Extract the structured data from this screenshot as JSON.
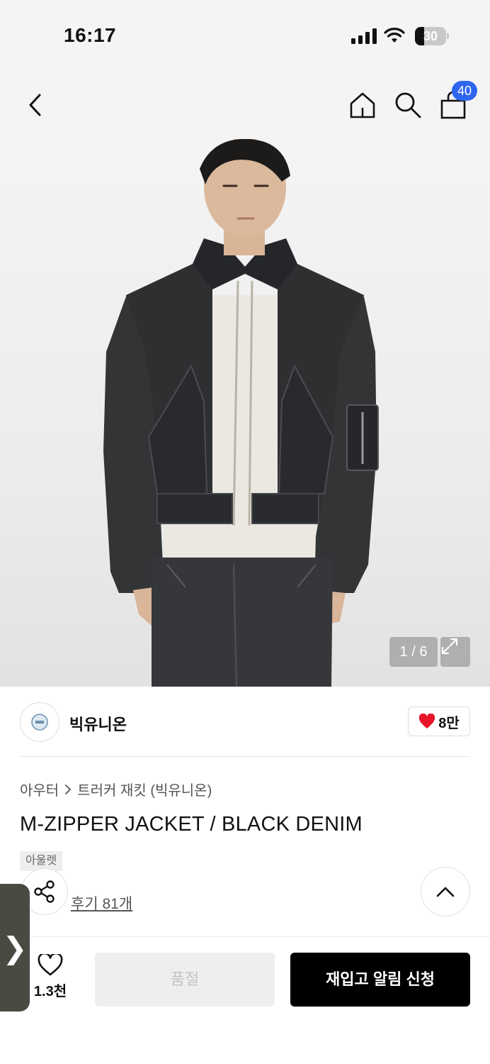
{
  "status_bar": {
    "time": "16:17",
    "battery": "30",
    "battery_level": 0.3
  },
  "nav": {
    "back_icon": "chevron-left-icon",
    "home_icon": "home-icon",
    "search_icon": "search-icon",
    "cart_icon": "shopping-bag-icon",
    "cart_badge": "40"
  },
  "gallery": {
    "page_indicator": "1 / 6",
    "expand_icon": "expand-icon"
  },
  "brand": {
    "name": "빅유니온",
    "like_count": "8만",
    "heart_color": "#e8142a"
  },
  "product": {
    "breadcrumb": [
      "아우터",
      "트러커 재킷 (빅유니온)"
    ],
    "title": "M-ZIPPER JACKET / BLACK DENIM",
    "tag": "아울렛",
    "reviews": "후기 81개"
  },
  "actions": {
    "wish_count": "1.3천",
    "soldout_label": "품절",
    "restock_label": "재입고 알림 신청"
  },
  "colors": {
    "accent": "#2f66f0",
    "primary_button": "#000000"
  }
}
